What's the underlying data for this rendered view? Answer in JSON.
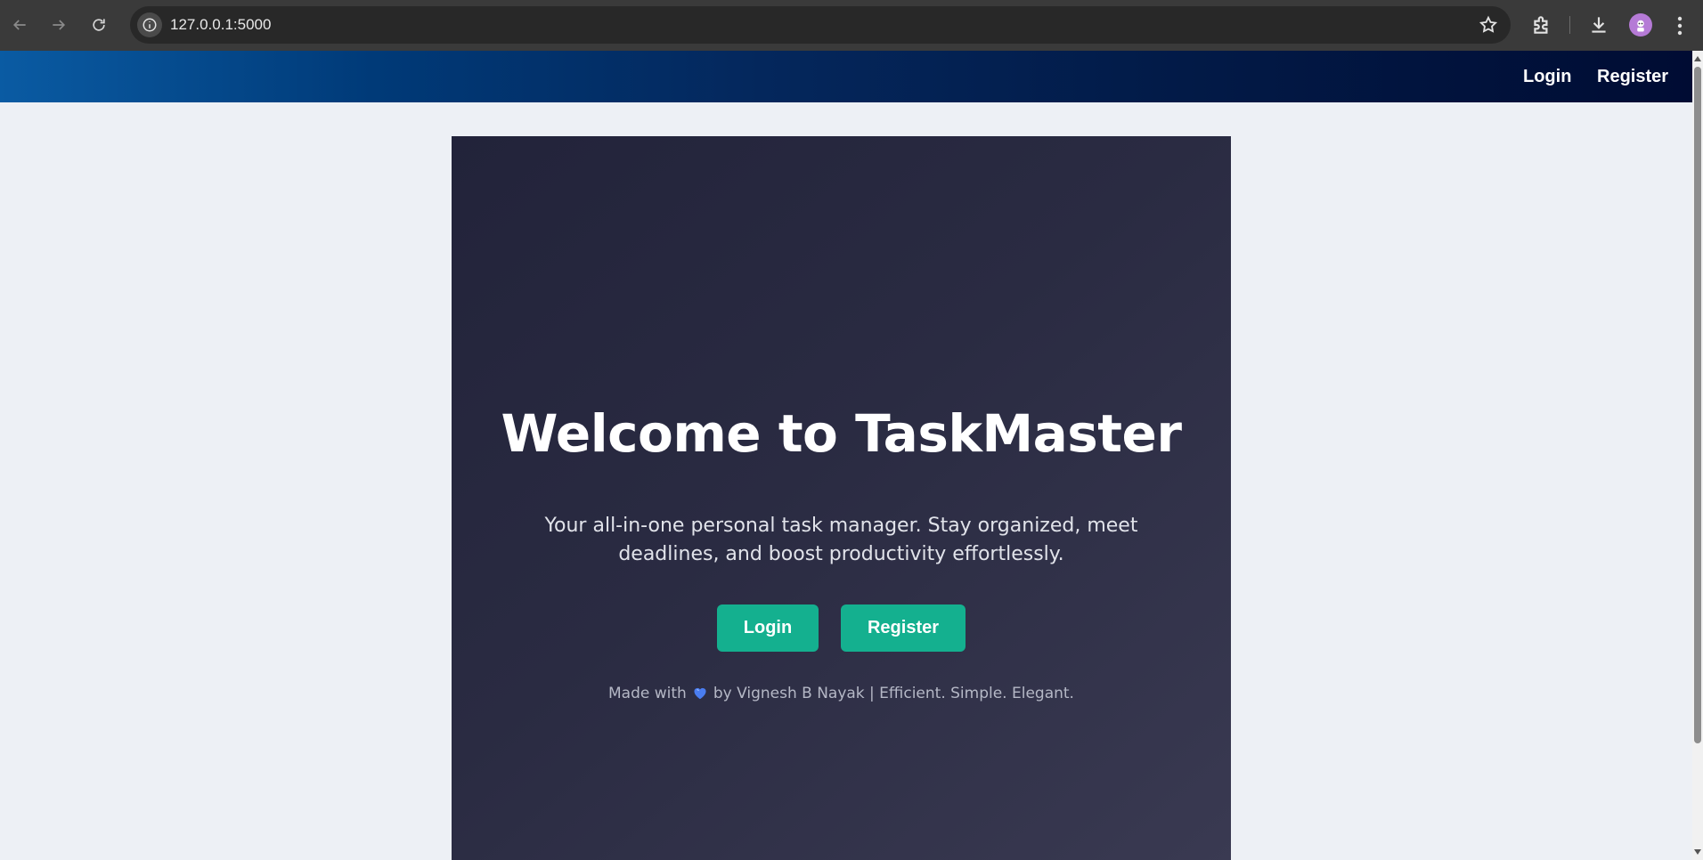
{
  "browser": {
    "url": "127.0.0.1:5000",
    "icons": {
      "back": "back-arrow-icon",
      "forward": "forward-arrow-icon",
      "reload": "reload-icon",
      "site_info": "info-icon",
      "bookmark": "star-icon",
      "extensions": "puzzle-icon",
      "downloads": "download-icon",
      "profile": "avatar",
      "menu": "kebab-menu-icon"
    }
  },
  "navbar": {
    "login_label": "Login",
    "register_label": "Register"
  },
  "hero": {
    "title": "Welcome to TaskMaster",
    "subtitle": "Your all-in-one personal task manager. Stay organized, meet deadlines, and boost productivity effortlessly.",
    "login_button": "Login",
    "register_button": "Register",
    "footer_prefix": "Made with",
    "footer_suffix": "by Vignesh B Nayak | Efficient. Simple. Elegant.",
    "heart_icon": "blue-heart-icon"
  },
  "colors": {
    "accent_button": "#14b08f",
    "hero_background": "#2a2b42",
    "page_background": "#edf0f5",
    "navbar_start": "#0a5ba3",
    "navbar_end": "#000c33",
    "heart": "#4a7df0"
  }
}
